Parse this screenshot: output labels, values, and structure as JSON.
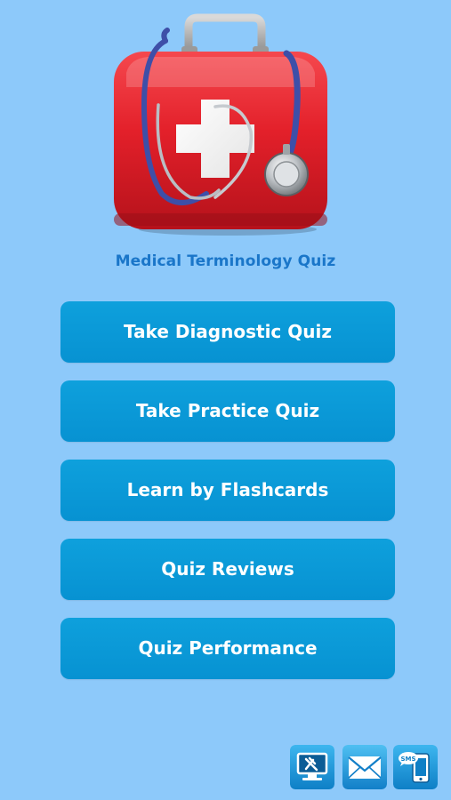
{
  "app": {
    "title": "Medical Terminology Quiz",
    "logo_icon": "first-aid-kit-stethoscope-icon"
  },
  "menu": {
    "items": [
      {
        "label": "Take Diagnostic Quiz"
      },
      {
        "label": "Take Practice Quiz"
      },
      {
        "label": "Learn by Flashcards"
      },
      {
        "label": "Quiz Reviews"
      },
      {
        "label": "Quiz Performance"
      }
    ]
  },
  "footer_icons": {
    "items": [
      {
        "icon": "more-apps-icon"
      },
      {
        "icon": "email-icon"
      },
      {
        "icon": "sms-icon",
        "label": "SMS"
      }
    ]
  },
  "colors": {
    "background": "#8dc9fa",
    "button": "#0a99d8",
    "button_text": "#ffffff",
    "title_text": "#1a76c9",
    "kit_red": "#e3202a"
  }
}
